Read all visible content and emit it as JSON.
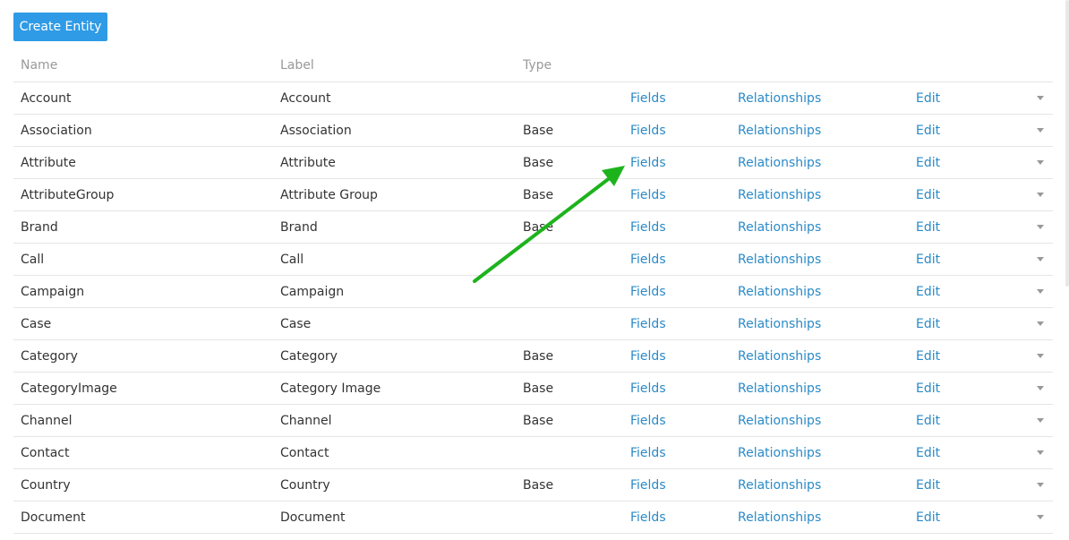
{
  "toolbar": {
    "create_label": "Create Entity"
  },
  "columns": {
    "name": "Name",
    "label": "Label",
    "type": "Type"
  },
  "links": {
    "fields": "Fields",
    "relationships": "Relationships",
    "edit": "Edit"
  },
  "rows": [
    {
      "name": "Account",
      "label": "Account",
      "type": ""
    },
    {
      "name": "Association",
      "label": "Association",
      "type": "Base"
    },
    {
      "name": "Attribute",
      "label": "Attribute",
      "type": "Base"
    },
    {
      "name": "AttributeGroup",
      "label": "Attribute Group",
      "type": "Base"
    },
    {
      "name": "Brand",
      "label": "Brand",
      "type": "Base"
    },
    {
      "name": "Call",
      "label": "Call",
      "type": ""
    },
    {
      "name": "Campaign",
      "label": "Campaign",
      "type": ""
    },
    {
      "name": "Case",
      "label": "Case",
      "type": ""
    },
    {
      "name": "Category",
      "label": "Category",
      "type": "Base"
    },
    {
      "name": "CategoryImage",
      "label": "Category Image",
      "type": "Base"
    },
    {
      "name": "Channel",
      "label": "Channel",
      "type": "Base"
    },
    {
      "name": "Contact",
      "label": "Contact",
      "type": ""
    },
    {
      "name": "Country",
      "label": "Country",
      "type": "Base"
    },
    {
      "name": "Document",
      "label": "Document",
      "type": ""
    }
  ],
  "annotation": {
    "color": "#1db31d",
    "icon": "arrow-icon"
  }
}
